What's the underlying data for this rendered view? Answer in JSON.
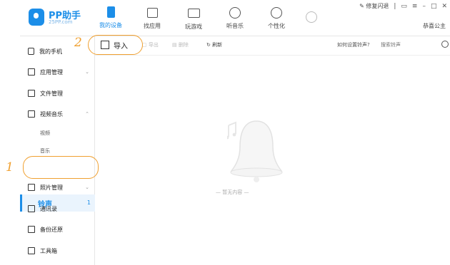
{
  "app": {
    "logo_title": "PP助手",
    "logo_subtitle": "25PP.com",
    "brand_color": "#1c8ee8",
    "annotation_color": "#f0a030"
  },
  "topbar": {
    "nav": [
      {
        "label": "我的设备",
        "icon": "phone-icon",
        "active": true
      },
      {
        "label": "找应用",
        "icon": "shopping-bag-icon",
        "active": false
      },
      {
        "label": "玩游戏",
        "icon": "gamepad-icon",
        "active": false
      },
      {
        "label": "听音乐",
        "icon": "disc-icon",
        "active": false
      },
      {
        "label": "个性化",
        "icon": "smile-icon",
        "active": false
      }
    ],
    "repair_label": "修复闪退",
    "user_name": "恭喜公主"
  },
  "sidebar": {
    "items": [
      {
        "label": "我的手机",
        "icon": "phone-icon"
      },
      {
        "label": "应用管理",
        "icon": "apps-grid-icon"
      },
      {
        "label": "文件管理",
        "icon": "folder-icon"
      },
      {
        "label": "视频音乐",
        "icon": "video-icon"
      },
      {
        "label": "照片管理",
        "icon": "photo-icon"
      },
      {
        "label": "通讯录",
        "icon": "contacts-icon"
      },
      {
        "label": "备份还原",
        "icon": "backup-icon"
      },
      {
        "label": "工具箱",
        "icon": "toolbox-icon"
      }
    ],
    "subitems": [
      "视频",
      "音乐"
    ],
    "selected": {
      "label": "铃声",
      "count": "1"
    }
  },
  "toolbar": {
    "import_label": "导入",
    "export_label": "导出",
    "delete_label": "删除",
    "refresh_label": "刷新",
    "help_label": "如何设置铃声?",
    "search_placeholder": "搜索铃声"
  },
  "content": {
    "empty_text": "— 暂无内容 —"
  },
  "annotations": {
    "step1": "1",
    "step2": "2"
  }
}
